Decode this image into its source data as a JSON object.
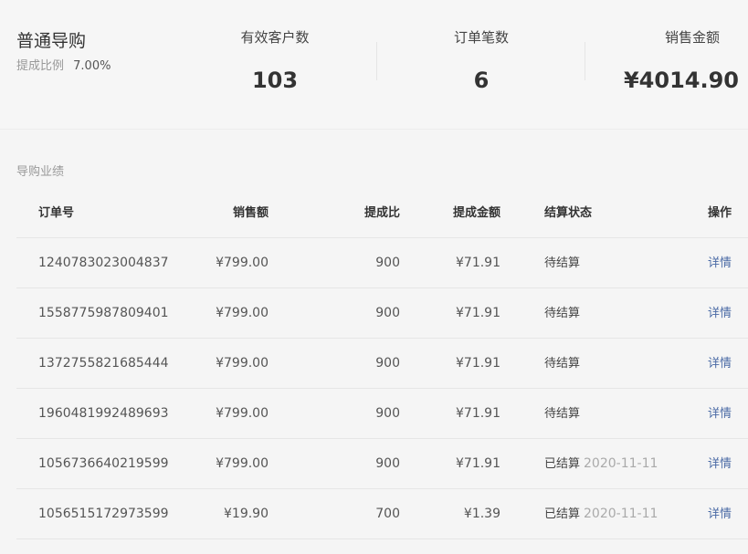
{
  "header": {
    "role_title": "普通导购",
    "commission_label": "提成比例",
    "commission_value": "7.00%",
    "stats": [
      {
        "label": "有效客户数",
        "value": "103"
      },
      {
        "label": "订单笔数",
        "value": "6"
      },
      {
        "label": "销售金额",
        "value": "¥4014.90"
      }
    ]
  },
  "section_title": "导购业绩",
  "table": {
    "columns": [
      "订单号",
      "销售额",
      "提成比",
      "提成金额",
      "结算状态",
      "操作"
    ],
    "rows": [
      {
        "order": "1240783023004837",
        "sales": "¥799.00",
        "rate": "900",
        "amount": "¥71.91",
        "status": "待结算",
        "date": "",
        "op": "详情"
      },
      {
        "order": "1558775987809401",
        "sales": "¥799.00",
        "rate": "900",
        "amount": "¥71.91",
        "status": "待结算",
        "date": "",
        "op": "详情"
      },
      {
        "order": "1372755821685444",
        "sales": "¥799.00",
        "rate": "900",
        "amount": "¥71.91",
        "status": "待结算",
        "date": "",
        "op": "详情"
      },
      {
        "order": "1960481992489693",
        "sales": "¥799.00",
        "rate": "900",
        "amount": "¥71.91",
        "status": "待结算",
        "date": "",
        "op": "详情"
      },
      {
        "order": "1056736640219599",
        "sales": "¥799.00",
        "rate": "900",
        "amount": "¥71.91",
        "status": "已结算",
        "date": "2020-11-11",
        "op": "详情"
      },
      {
        "order": "1056515172973599",
        "sales": "¥19.90",
        "rate": "700",
        "amount": "¥1.39",
        "status": "已结算",
        "date": "2020-11-11",
        "op": "详情"
      }
    ]
  }
}
